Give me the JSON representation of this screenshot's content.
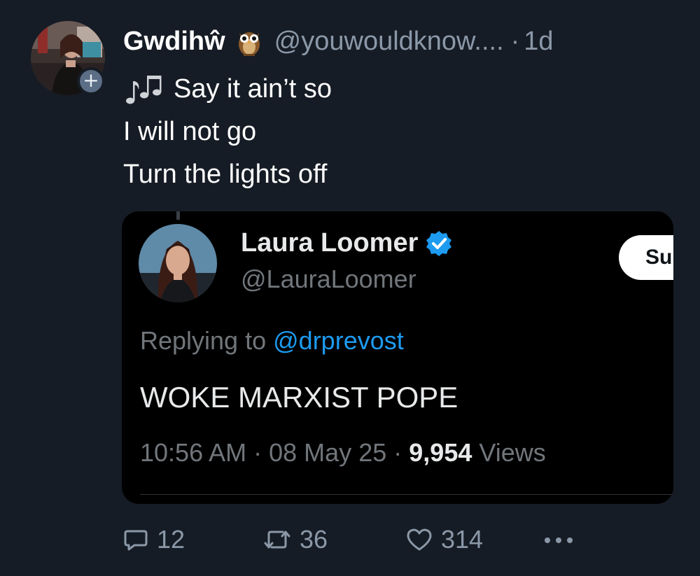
{
  "author": {
    "display_name": "Gwdihŵ",
    "handle": "@youwouldknow....",
    "separator": "·",
    "time": "1d",
    "avatar_icon": "profile-photo",
    "badge_icon": "owl-emoji"
  },
  "tweet": {
    "lines": [
      "Say it ain’t so",
      "I will not go",
      "Turn the lights off"
    ],
    "leading_icon": "musical-notes-emoji"
  },
  "quoted": {
    "display_name": "Laura Loomer",
    "handle": "@LauraLoomer",
    "verified_icon": "verified-badge",
    "button_label": "Su",
    "replying_prefix": "Replying to",
    "replying_mention": "@drprevost",
    "body": "WOKE MARXIST POPE",
    "time": "10:56 AM",
    "date": "08 May 25",
    "views_count": "9,954",
    "views_label": "Views",
    "meta_sep": "·"
  },
  "actions": {
    "replies": "12",
    "reposts": "36",
    "likes": "314"
  },
  "colors": {
    "background": "#161c25",
    "muted": "#8b98a8",
    "accent": "#1d9bf0",
    "card_bg": "#000000"
  }
}
